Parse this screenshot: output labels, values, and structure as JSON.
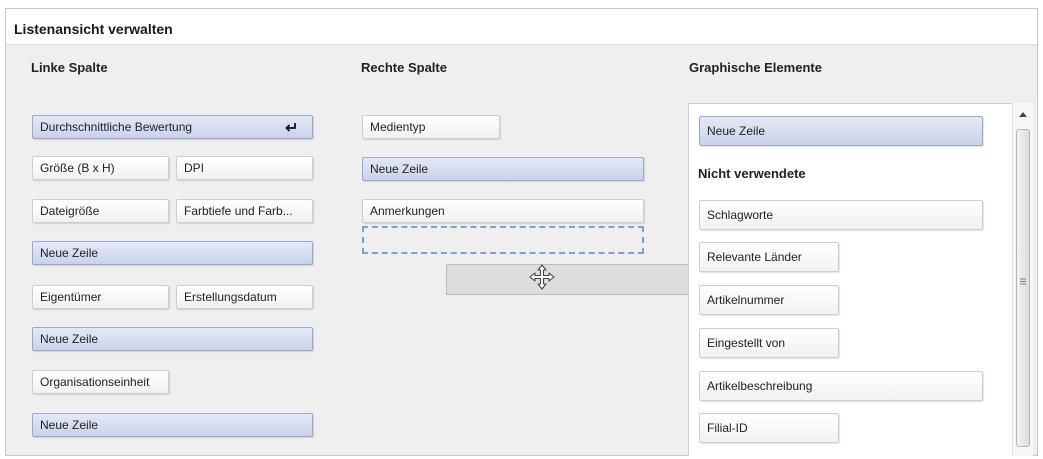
{
  "panel": {
    "title": "Listenansicht verwalten"
  },
  "columns": {
    "left": {
      "title": "Linke Spalte"
    },
    "right": {
      "title": "Rechte Spalte"
    },
    "graphic": {
      "title": "Graphische Elemente",
      "unused_heading": "Nicht verwendete"
    }
  },
  "left_items": {
    "durchschnitt": "Durchschnittliche Bewertung",
    "groesse": "Größe (B x H)",
    "dpi": "DPI",
    "dateigroesse": "Dateigröße",
    "farbtiefe": "Farbtiefe und Farb...",
    "neue_zeile_1": "Neue Zeile",
    "eigentuemer": "Eigentümer",
    "erstellungsdatum": "Erstellungsdatum",
    "neue_zeile_2": "Neue Zeile",
    "organisation": "Organisationseinheit",
    "neue_zeile_3": "Neue Zeile"
  },
  "right_items": {
    "medientyp": "Medientyp",
    "neue_zeile": "Neue Zeile",
    "anmerkungen": "Anmerkungen"
  },
  "graphic_items": {
    "neue_zeile": "Neue Zeile",
    "schlagworte": "Schlagworte",
    "relevante_laender": "Relevante Länder",
    "artikelnummer": "Artikelnummer",
    "eingestellt_von": "Eingestellt von",
    "artikelbeschreibung": "Artikelbeschreibung",
    "filial_id": "Filial-ID"
  },
  "icons": {
    "enter": "enter-icon",
    "move": "move-icon",
    "scroll_up": "chevron-up-icon",
    "grip": "grip-icon"
  },
  "colors": {
    "row_item": "#c9d2ec",
    "row_border": "#9ba7cf",
    "dropzone": "#7d9fd4",
    "panel_bg": "#efefef"
  }
}
